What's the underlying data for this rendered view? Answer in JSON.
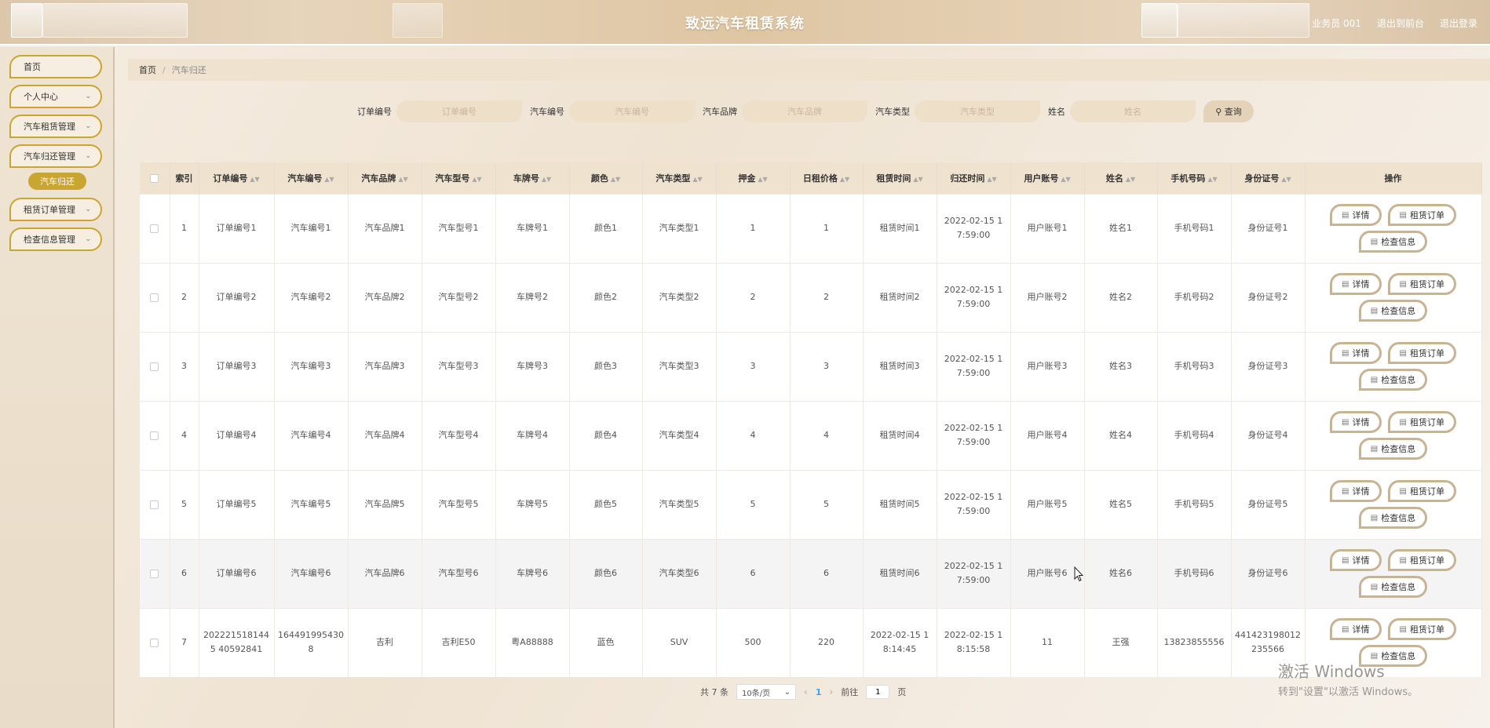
{
  "header": {
    "title": "致远汽车租赁系统",
    "user": "业务员 001",
    "link_front": "退出到前台",
    "link_logout": "退出登录"
  },
  "sidebar": {
    "home": "首页",
    "personal": "个人中心",
    "rental_mgmt": "汽车租赁管理",
    "return_mgmt": "汽车归还管理",
    "return_sub": "汽车归还",
    "order_mgmt": "租赁订单管理",
    "inspect_mgmt": "检查信息管理"
  },
  "breadcrumb": {
    "home": "首页",
    "current": "汽车归还"
  },
  "search": {
    "order_label": "订单编号",
    "order_placeholder": "订单编号",
    "car_no_label": "汽车编号",
    "car_no_placeholder": "汽车编号",
    "brand_label": "汽车品牌",
    "brand_placeholder": "汽车品牌",
    "type_label": "汽车类型",
    "type_placeholder": "汽车类型",
    "name_label": "姓名",
    "name_placeholder": "姓名",
    "query_button": "查询"
  },
  "table": {
    "columns": [
      "索引",
      "订单编号",
      "汽车编号",
      "汽车品牌",
      "汽车型号",
      "车牌号",
      "颜色",
      "汽车类型",
      "押金",
      "日租价格",
      "租赁时间",
      "归还时间",
      "用户账号",
      "姓名",
      "手机号码",
      "身份证号",
      "操作"
    ],
    "rows": [
      {
        "index": "1",
        "order": "订单编号1",
        "car_no": "汽车编号1",
        "brand": "汽车品牌1",
        "model": "汽车型号1",
        "plate": "车牌号1",
        "color": "颜色1",
        "type": "汽车类型1",
        "deposit": "1",
        "price": "1",
        "rent_time": "租赁时间1",
        "return_time": "2022-02-15 17:59:00",
        "account": "用户账号1",
        "name": "姓名1",
        "phone": "手机号码1",
        "idno": "身份证号1"
      },
      {
        "index": "2",
        "order": "订单编号2",
        "car_no": "汽车编号2",
        "brand": "汽车品牌2",
        "model": "汽车型号2",
        "plate": "车牌号2",
        "color": "颜色2",
        "type": "汽车类型2",
        "deposit": "2",
        "price": "2",
        "rent_time": "租赁时间2",
        "return_time": "2022-02-15 17:59:00",
        "account": "用户账号2",
        "name": "姓名2",
        "phone": "手机号码2",
        "idno": "身份证号2"
      },
      {
        "index": "3",
        "order": "订单编号3",
        "car_no": "汽车编号3",
        "brand": "汽车品牌3",
        "model": "汽车型号3",
        "plate": "车牌号3",
        "color": "颜色3",
        "type": "汽车类型3",
        "deposit": "3",
        "price": "3",
        "rent_time": "租赁时间3",
        "return_time": "2022-02-15 17:59:00",
        "account": "用户账号3",
        "name": "姓名3",
        "phone": "手机号码3",
        "idno": "身份证号3"
      },
      {
        "index": "4",
        "order": "订单编号4",
        "car_no": "汽车编号4",
        "brand": "汽车品牌4",
        "model": "汽车型号4",
        "plate": "车牌号4",
        "color": "颜色4",
        "type": "汽车类型4",
        "deposit": "4",
        "price": "4",
        "rent_time": "租赁时间4",
        "return_time": "2022-02-15 17:59:00",
        "account": "用户账号4",
        "name": "姓名4",
        "phone": "手机号码4",
        "idno": "身份证号4"
      },
      {
        "index": "5",
        "order": "订单编号5",
        "car_no": "汽车编号5",
        "brand": "汽车品牌5",
        "model": "汽车型号5",
        "plate": "车牌号5",
        "color": "颜色5",
        "type": "汽车类型5",
        "deposit": "5",
        "price": "5",
        "rent_time": "租赁时间5",
        "return_time": "2022-02-15 17:59:00",
        "account": "用户账号5",
        "name": "姓名5",
        "phone": "手机号码5",
        "idno": "身份证号5"
      },
      {
        "index": "6",
        "order": "订单编号6",
        "car_no": "汽车编号6",
        "brand": "汽车品牌6",
        "model": "汽车型号6",
        "plate": "车牌号6",
        "color": "颜色6",
        "type": "汽车类型6",
        "deposit": "6",
        "price": "6",
        "rent_time": "租赁时间6",
        "return_time": "2022-02-15 17:59:00",
        "account": "用户账号6",
        "name": "姓名6",
        "phone": "手机号码6",
        "idno": "身份证号6"
      },
      {
        "index": "7",
        "order": "2022215181445 40592841",
        "car_no": "164491995430 8",
        "brand": "吉利",
        "model": "吉利E50",
        "plate": "粤A88888",
        "color": "蓝色",
        "type": "SUV",
        "deposit": "500",
        "price": "220",
        "rent_time": "2022-02-15 18:14:45",
        "return_time": "2022-02-15 18:15:58",
        "account": "11",
        "name": "王强",
        "phone": "13823855556",
        "idno": "441423198012 235566"
      }
    ],
    "actions": {
      "detail": "详情",
      "order": "租赁订单",
      "inspect": "检查信息"
    },
    "hover_row": 6
  },
  "pagination": {
    "total": "共 7 条",
    "page_size": "10条/页",
    "current_page": "1",
    "goto_label": "前往",
    "goto_value": "1",
    "page_unit": "页"
  },
  "watermark": {
    "line1": "激活 Windows",
    "line2": "转到\"设置\"以激活 Windows。"
  },
  "colors": {
    "accent": "#c9a532",
    "header_bg": "#dfc6a3",
    "table_header_bg": "#efe2cf",
    "button_border": "#c8b393"
  }
}
